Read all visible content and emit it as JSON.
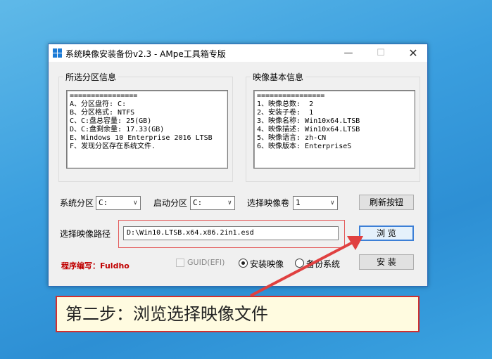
{
  "window": {
    "title": "系统映像安装备份v2.3 - AMpe工具箱专版",
    "min_glyph": "—",
    "max_glyph": "☐",
    "close_glyph": "✕"
  },
  "left_group": {
    "title": "所选分区信息",
    "text": "================\nA、分区盘符: C:\nB、分区格式: NTFS\nC、C:盘总容量: 25(GB)\nD、C:盘剩余量: 17.33(GB)\nE、Windows 10 Enterprise 2016 LTSB\nF、发现分区存在系统文件."
  },
  "right_group": {
    "title": "映像基本信息",
    "text": "================\n1、映像总数:  2\n2、安装子卷:  1\n3、映像名称: Win10x64.LTSB\n4、映像描述: Win10x64.LTSB\n5、映像语言: zh-CN\n6、映像版本: EnterpriseS"
  },
  "controls": {
    "system_partition_label": "系统分区",
    "system_partition_value": "C:",
    "boot_partition_label": "启动分区",
    "boot_partition_value": "C:",
    "image_volume_label": "选择映像卷",
    "image_volume_value": "1",
    "refresh_button": "刷新按钮",
    "image_path_label": "选择映像路径",
    "image_path_value": "D:\\Win10.LTSB.x64.x86.2in1.esd",
    "browse_button": "浏 览",
    "install_button": "安 装",
    "author": "程序编写：Fuldho",
    "guid_checkbox_label": "GUID(EFI)",
    "install_radio_label": "安装映像",
    "backup_radio_label": "备份系统"
  },
  "annotation": {
    "callout_text": "第二步：浏览选择映像文件"
  },
  "colors": {
    "accent_red": "#e04040",
    "author_red": "#c00000",
    "focus_blue": "#3c7fd6"
  }
}
